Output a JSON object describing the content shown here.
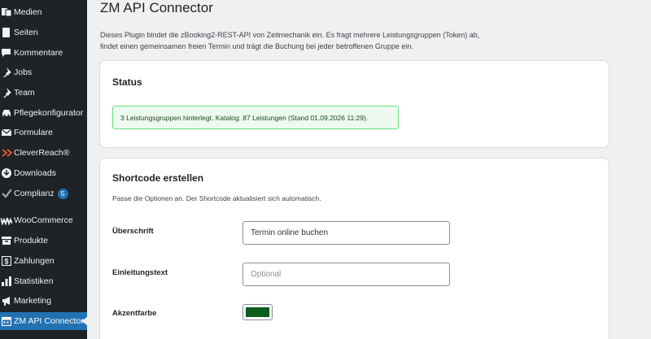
{
  "sidebar": {
    "items": [
      {
        "label": "Medien",
        "icon": "media-icon"
      },
      {
        "label": "Seiten",
        "icon": "page-icon"
      },
      {
        "label": "Kommentare",
        "icon": "comment-icon"
      },
      {
        "label": "Jobs",
        "icon": "pin-icon"
      },
      {
        "label": "Team",
        "icon": "pin-icon"
      },
      {
        "label": "Pflegekonfigurator",
        "icon": "car-icon"
      },
      {
        "label": "Formulare",
        "icon": "mail-icon"
      },
      {
        "label": "CleverReach®",
        "icon": "cleverreach-icon"
      },
      {
        "label": "Downloads",
        "icon": "download-icon"
      },
      {
        "label": "Complianz",
        "icon": "check-icon",
        "badge": "5"
      },
      {
        "label": "WooCommerce",
        "icon": "woocommerce-icon"
      },
      {
        "label": "Produkte",
        "icon": "archive-icon"
      },
      {
        "label": "Zahlungen",
        "icon": "payment-icon"
      },
      {
        "label": "Statistiken",
        "icon": "bar-chart-icon"
      },
      {
        "label": "Marketing",
        "icon": "megaphone-icon"
      },
      {
        "label": "ZM API Connector",
        "icon": "calendar-icon",
        "active": true
      }
    ]
  },
  "page": {
    "title": "ZM API Connector",
    "intro_line1": "Dieses Plugin bindet die zBooking2-REST-API von Zeitmechanik ein. Es fragt mehrere Leistungsgruppen (Token) ab,",
    "intro_line2": "findet einen gemeinsamen freien Termin und trägt die Buchung bei jeder betroffenen Gruppe ein."
  },
  "status_card": {
    "title": "Status",
    "notice": "3 Leistungsgruppen hinterlegt. Katalog: 87 Leistungen (Stand 01.09.2026 11:29)."
  },
  "shortcode_card": {
    "title": "Shortcode erstellen",
    "hint": "Passe die Optionen an. Der Shortcode aktualisiert sich automatisch.",
    "fields": {
      "heading_label": "Überschrift",
      "heading_value": "Termin online buchen",
      "intro_label": "Einleitungstext",
      "intro_placeholder": "Optional",
      "accent_label": "Akzentfarbe",
      "accent_color": "#0b5c1f"
    }
  },
  "colors": {
    "sidebar_bg": "#1d2327",
    "active_bg": "#2271b1",
    "cleverreach": "#e2532d",
    "notice_border": "#68de7c"
  }
}
